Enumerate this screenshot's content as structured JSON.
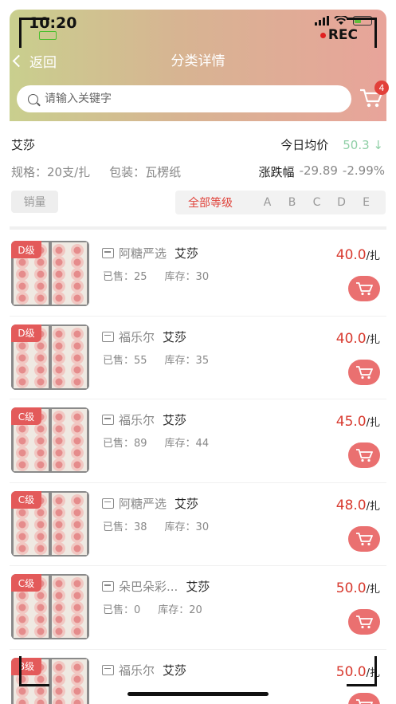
{
  "status": {
    "time": "10:20",
    "rec": "REC"
  },
  "header": {
    "back_label": "返回",
    "title": "分类详情"
  },
  "search": {
    "placeholder": "请输入关键字"
  },
  "cart": {
    "badge": "4"
  },
  "product": {
    "name": "艾莎",
    "avg_label": "今日均价",
    "avg_value": "50.3",
    "avg_trend": "↓",
    "spec": "规格：20支/扎",
    "package": "包装：瓦楞纸",
    "change_label": "涨跌幅",
    "change_abs": "-29.89",
    "change_pct": "-2.99%"
  },
  "filters": {
    "sort_label": "销量",
    "grades": [
      "全部等级",
      "A",
      "B",
      "C",
      "D",
      "E"
    ],
    "active_grade": "全部等级"
  },
  "colors": {
    "accent": "#d83a2f",
    "cart_button": "#ea7070",
    "grade_tag": "#e35a5a",
    "avg_value": "#8fcfa6"
  },
  "items": [
    {
      "grade": "D级",
      "shop": "阿糖严选",
      "variety": "艾莎",
      "sold": "已售：25",
      "stock": "库存：30",
      "price": "40.0",
      "unit": "/扎"
    },
    {
      "grade": "D级",
      "shop": "福乐尔",
      "variety": "艾莎",
      "sold": "已售：55",
      "stock": "库存：35",
      "price": "40.0",
      "unit": "/扎"
    },
    {
      "grade": "C级",
      "shop": "福乐尔",
      "variety": "艾莎",
      "sold": "已售：89",
      "stock": "库存：44",
      "price": "45.0",
      "unit": "/扎"
    },
    {
      "grade": "C级",
      "shop": "阿糖严选",
      "variety": "艾莎",
      "sold": "已售：38",
      "stock": "库存：30",
      "price": "48.0",
      "unit": "/扎"
    },
    {
      "grade": "C级",
      "shop": "朵巴朵彩...",
      "variety": "艾莎",
      "sold": "已售：0",
      "stock": "库存：20",
      "price": "50.0",
      "unit": "/扎"
    },
    {
      "grade": "B级",
      "shop": "福乐尔",
      "variety": "艾莎",
      "sold": "",
      "stock": "",
      "price": "50.0",
      "unit": "/扎"
    }
  ]
}
